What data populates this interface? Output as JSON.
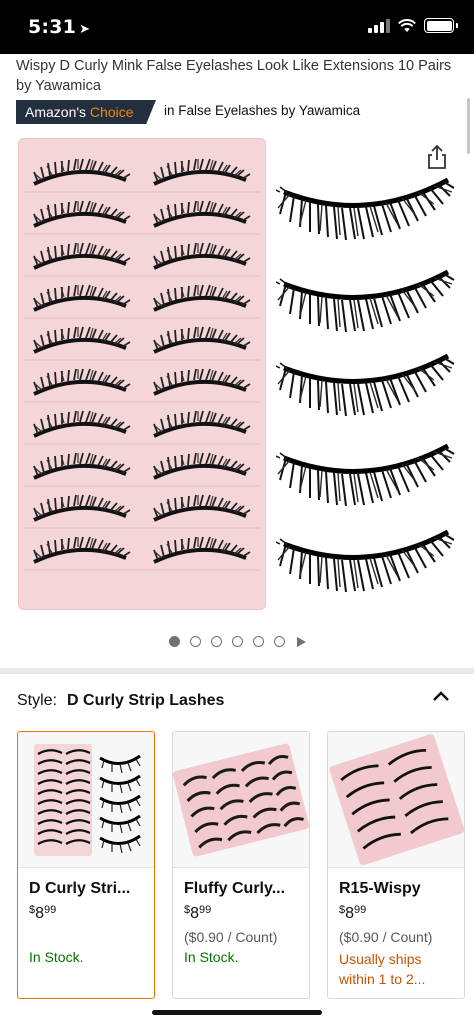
{
  "status": {
    "time": "5:31",
    "location_icon": "location-arrow-icon"
  },
  "product": {
    "title": "Wispy D Curly Mink False Eyelashes Look Like Extensions 10 Pairs by Yawamica",
    "badge_prefix": "Amazon's",
    "badge_choice": "Choice",
    "badge_category": "in False Eyelashes by Yawamica",
    "image_count": 6,
    "active_image": 1
  },
  "style": {
    "label": "Style:",
    "value": "D Curly Strip Lashes"
  },
  "options": [
    {
      "name": "D Curly Stri...",
      "currency": "$",
      "price_whole": "8",
      "price_fraction": "99",
      "per_count": "",
      "availability": "In Stock.",
      "availability_type": "instock",
      "selected": true
    },
    {
      "name": "Fluffy Curly...",
      "currency": "$",
      "price_whole": "8",
      "price_fraction": "99",
      "per_count": "($0.90 / Count)",
      "availability": "In Stock.",
      "availability_type": "instock",
      "selected": false
    },
    {
      "name": "R15-Wispy",
      "currency": "$",
      "price_whole": "8",
      "price_fraction": "99",
      "per_count": "($0.90 / Count)",
      "availability": "Usually ships within 1 to 2...",
      "availability_type": "ships",
      "selected": false
    }
  ],
  "colors": {
    "badge_bg": "#232f3e",
    "choice_orange": "#f08804",
    "in_stock": "#007600",
    "ships": "#c45500",
    "selected_border": "#e77600",
    "palette_pink": "#f4d5d8"
  }
}
